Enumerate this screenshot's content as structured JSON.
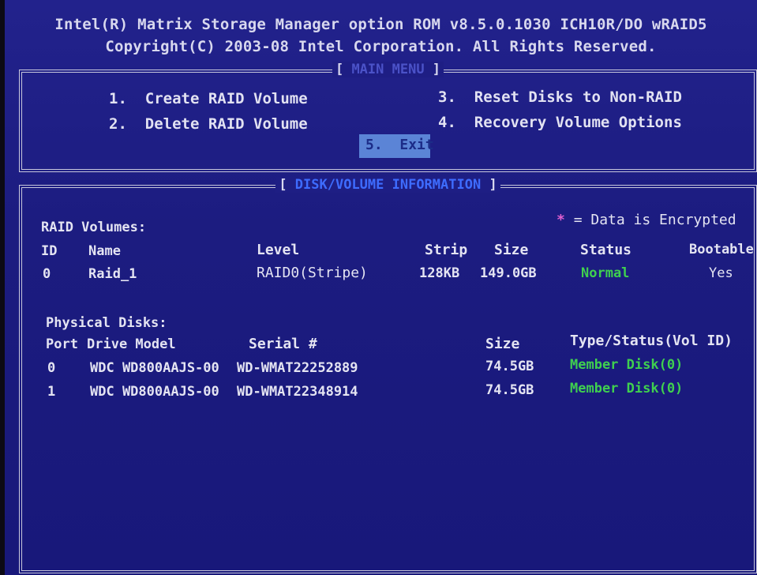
{
  "header": {
    "line1": "Intel(R) Matrix Storage Manager option ROM v8.5.0.1030 ICH10R/DO wRAID5",
    "line2": "Copyright(C) 2003-08 Intel Corporation.  All Rights Reserved."
  },
  "main_menu": {
    "title": "MAIN MENU",
    "items": [
      {
        "num": "1.",
        "label": "Create RAID Volume"
      },
      {
        "num": "2.",
        "label": "Delete RAID Volume"
      },
      {
        "num": "3.",
        "label": "Reset Disks to Non-RAID"
      },
      {
        "num": "4.",
        "label": "Recovery Volume Options"
      }
    ],
    "exit": {
      "num": "5.",
      "label": "Exit"
    }
  },
  "info": {
    "title": "DISK/VOLUME INFORMATION",
    "encrypted_marker": "*",
    "encrypted_legend": "= Data is Encrypted",
    "raid_heading": "RAID Volumes:",
    "raid_columns": [
      "ID",
      "Name",
      "Level",
      "Strip",
      "Size",
      "Status",
      "Bootable"
    ],
    "raid_rows": [
      {
        "id": "0",
        "name": "Raid_1",
        "level": "RAID0(Stripe)",
        "strip": "128KB",
        "size": "149.0GB",
        "status": "Normal",
        "bootable": "Yes"
      }
    ],
    "phys_heading": "Physical Disks:",
    "phys_columns": [
      "Port",
      "Drive Model",
      "Serial #",
      "Size",
      "Type/Status(Vol ID)"
    ],
    "phys_rows": [
      {
        "port": "0",
        "model": "WDC WD800AAJS-00",
        "serial": "WD-WMAT22252889",
        "size": "74.5GB",
        "status": "Member Disk(0)"
      },
      {
        "port": "1",
        "model": "WDC WD800AAJS-00",
        "serial": "WD-WMAT22348914",
        "size": "74.5GB",
        "status": "Member Disk(0)"
      }
    ]
  },
  "colors": {
    "background": "#1c1c80",
    "title_accent": "#3e6cff",
    "selection": "#5b84d6",
    "status_ok": "#3fd04f",
    "encrypted_marker": "#e060d0"
  }
}
